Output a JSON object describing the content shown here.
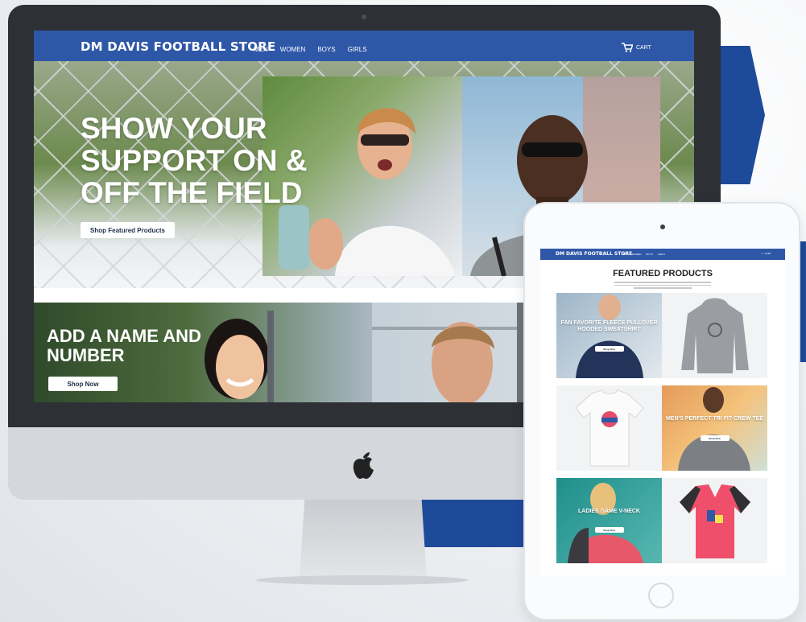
{
  "desktop": {
    "nav": {
      "brand": "DM DAVIS FOOTBALL STORE",
      "links": [
        "MEN",
        "WOMEN",
        "BOYS",
        "GIRLS"
      ],
      "cart_label": "CART"
    },
    "hero": {
      "title": "SHOW YOUR SUPPORT ON & OFF THE FIELD",
      "button": "Shop Featured Products"
    },
    "promo": {
      "title": "ADD A NAME AND NUMBER",
      "button": "Shop Now"
    }
  },
  "tablet": {
    "nav": {
      "brand": "DM DAVIS FOOTBALL STORE",
      "links": [
        "MEN",
        "WOMEN",
        "BOYS",
        "GIRLS"
      ],
      "cart_label": "CART"
    },
    "heading": "FEATURED PRODUCTS",
    "products": [
      {
        "label": "FAN FAVORITE FLEECE PULLOVER HOODED SWEATSHIRT",
        "button": "Shop Now"
      },
      {
        "label": "",
        "button": ""
      },
      {
        "label": "",
        "button": ""
      },
      {
        "label": "MEN'S PERFECT TRI FIT CREW TEE",
        "button": "Shop Now"
      },
      {
        "label": "LADIES GAME V-NECK",
        "button": "Shop Now"
      },
      {
        "label": "",
        "button": ""
      }
    ]
  },
  "colors": {
    "brand_blue": "#2f57a8",
    "accent_blue": "#1e4a9a",
    "monitor_bezel": "#2d3035"
  }
}
